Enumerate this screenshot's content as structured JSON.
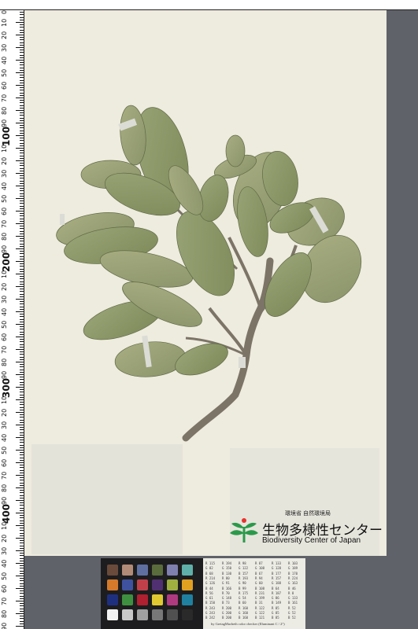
{
  "image": {
    "description_colors": {
      "background": "#5e6166",
      "sheet": "#eeebdf",
      "leaf": "#8f9a6a",
      "stem": "#7a7366",
      "logo_green": "#2a9a4a"
    }
  },
  "ruler": {
    "major_labels": [
      "100",
      "200",
      "300",
      "400",
      "500"
    ],
    "minor_labels": [
      "10",
      "20",
      "30",
      "40",
      "50",
      "60",
      "70",
      "80",
      "90",
      "10",
      "20",
      "30",
      "40",
      "50",
      "60",
      "70",
      "80",
      "90",
      "10",
      "20",
      "30",
      "40",
      "50",
      "60",
      "70",
      "80",
      "90",
      "10",
      "20",
      "30",
      "40",
      "50",
      "60",
      "70",
      "80",
      "90",
      "10",
      "20",
      "30",
      "40",
      "50",
      "60",
      "70",
      "80",
      "90"
    ],
    "zero_label": "0"
  },
  "logo": {
    "ministry": "環境省 自然環境局",
    "name_ja": "生物多様性センター",
    "name_en": "Biodiversity Center of Japan",
    "icon": "sprout-icon"
  },
  "color_chart": {
    "swatches": [
      "#6a4a3a",
      "#b28a78",
      "#5f6fa0",
      "#5a6b3c",
      "#7f7fb0",
      "#5fb0a8",
      "#d47a2a",
      "#3f52a0",
      "#c0404a",
      "#503070",
      "#9fb040",
      "#e0a020",
      "#1f2f80",
      "#3f8f40",
      "#b02030",
      "#e0c830",
      "#b03a80",
      "#2080a0",
      "#f2f2f2",
      "#c8c8c8",
      "#a0a0a0",
      "#787878",
      "#505050",
      "#2a2a2a"
    ]
  },
  "color_table": {
    "cells": [
      "R 115",
      "R 194",
      "R 98",
      "R 87",
      "R 133",
      "R 103",
      "G 82",
      "G 150",
      "G 122",
      "G 108",
      "G 128",
      "G 189",
      "B 68",
      "B 130",
      "B 157",
      "B 67",
      "B 177",
      "B 170",
      "R 214",
      "R 80",
      "R 193",
      "R 94",
      "R 157",
      "R 224",
      "G 126",
      "G 91",
      "G 90",
      "G 60",
      "G 188",
      "G 163",
      "B 44",
      "B 166",
      "B 99",
      "B 108",
      "B 64",
      "B 46",
      "R 56",
      "R 70",
      "R 175",
      "R 231",
      "R 187",
      "R 8",
      "G 61",
      "G 148",
      "G 54",
      "G 199",
      "G 86",
      "G 133",
      "B 150",
      "B 73",
      "B 60",
      "B 31",
      "B 149",
      "B 161",
      "R 243",
      "R 200",
      "R 160",
      "R 122",
      "R 85",
      "R 52",
      "G 243",
      "G 200",
      "G 160",
      "G 122",
      "G 85",
      "G 52",
      "B 242",
      "B 200",
      "B 160",
      "B 121",
      "B 85",
      "B 52"
    ],
    "caption": "by GretagMacbeth color checker  (Illuminant C / 2°)"
  }
}
